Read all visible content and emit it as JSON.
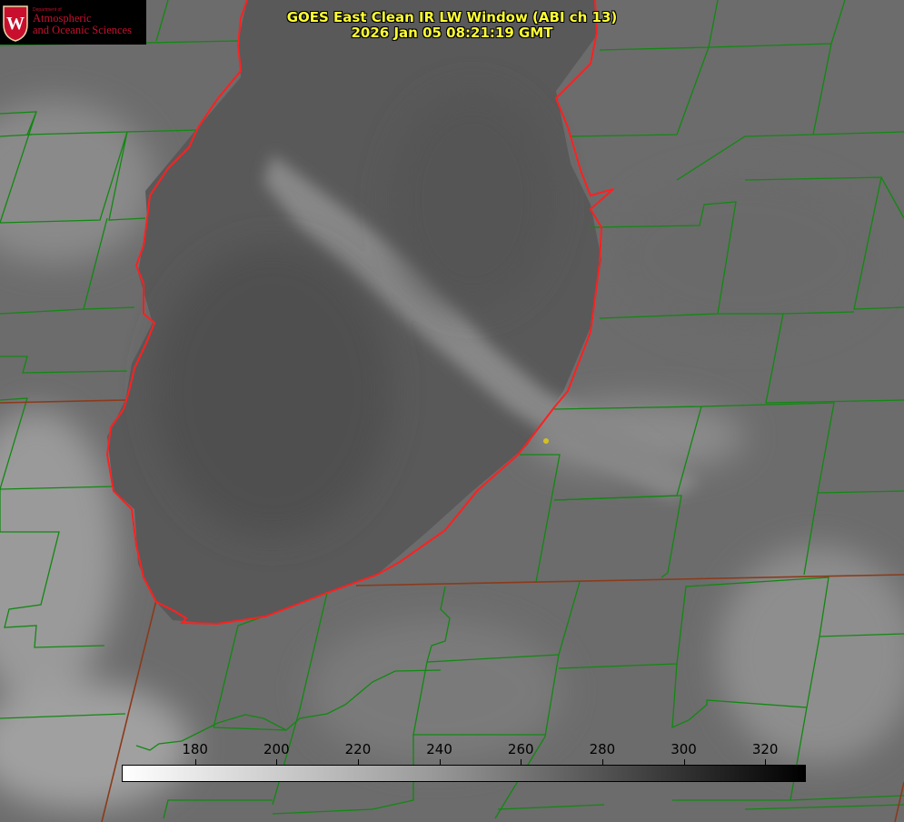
{
  "header": {
    "title_line1": "GOES East Clean IR LW Window (ABI ch 13)",
    "title_line2": "2026 Jan 05 08:21:19 GMT"
  },
  "logo": {
    "dept": "Department of",
    "line1": "Atmospheric",
    "line2": "and Oceanic Sciences",
    "crest_letter": "W"
  },
  "colorbar": {
    "min": 162,
    "max": 330,
    "ticks": [
      "180",
      "200",
      "220",
      "240",
      "260",
      "280",
      "300",
      "320"
    ]
  },
  "colors": {
    "title": "#ffff33",
    "coastline": "#ff2020",
    "county_lines": "#118811",
    "state_lines": "#8b3a1a",
    "marker": "#d4c020",
    "logo_red": "#c8102e"
  },
  "icons": {
    "crest": "uw-crest-icon",
    "marker": "station-dot-icon"
  }
}
